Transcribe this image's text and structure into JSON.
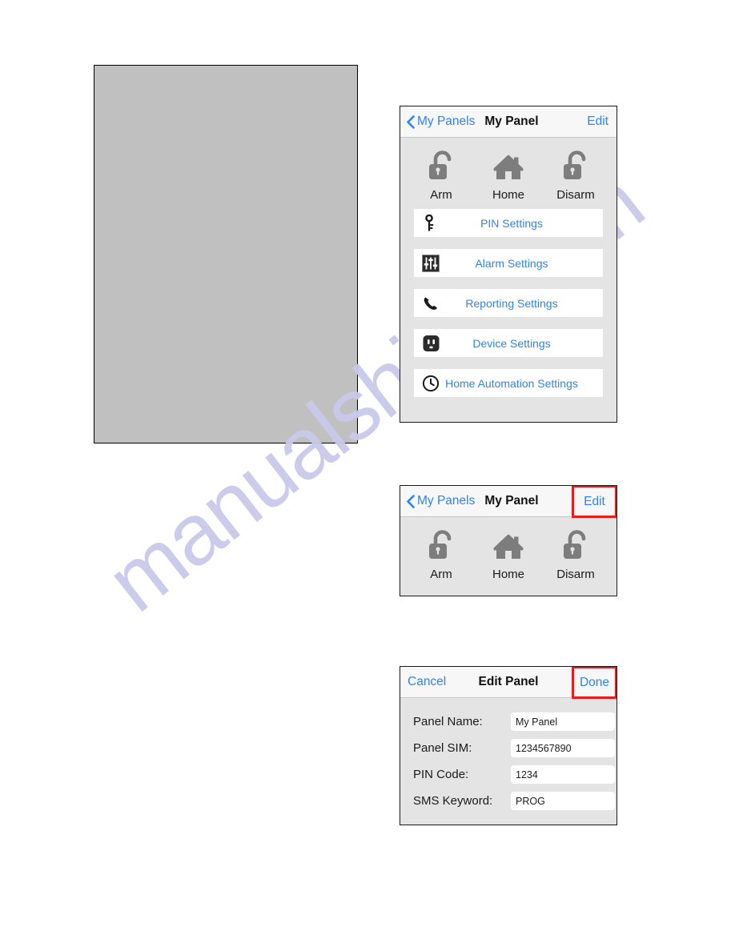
{
  "page": {
    "watermark_text": "manualshive.com",
    "watermark_color": "#c9c9ec",
    "accent_blue": "#2f84e8",
    "highlight_red": "#e81c1c"
  },
  "figure_placeholder": {
    "label": "blank-image-placeholder"
  },
  "panel_screen": {
    "nav": {
      "back_label": "My Panels",
      "title": "My Panel",
      "action_label": "Edit",
      "back_icon": "chevron-left-icon"
    },
    "modes": [
      {
        "label": "Arm",
        "icon": "open-padlock-icon"
      },
      {
        "label": "Home",
        "icon": "house-icon"
      },
      {
        "label": "Disarm",
        "icon": "open-padlock-icon"
      }
    ],
    "settings": [
      {
        "label": "PIN Settings",
        "icon": "key-icon"
      },
      {
        "label": "Alarm Settings",
        "icon": "sliders-icon"
      },
      {
        "label": "Reporting Settings",
        "icon": "phone-handset-icon"
      },
      {
        "label": "Device Settings",
        "icon": "power-outlet-icon"
      },
      {
        "label": "Home Automation Settings",
        "icon": "clock-icon"
      }
    ]
  },
  "panel_screen_edit_highlight": {
    "nav": {
      "back_label": "My Panels",
      "title": "My Panel",
      "action_label": "Edit",
      "back_icon": "chevron-left-icon"
    },
    "modes": [
      {
        "label": "Arm",
        "icon": "open-padlock-icon"
      },
      {
        "label": "Home",
        "icon": "house-icon"
      },
      {
        "label": "Disarm",
        "icon": "open-padlock-icon"
      }
    ]
  },
  "edit_panel_screen": {
    "nav": {
      "cancel_label": "Cancel",
      "title": "Edit Panel",
      "done_label": "Done"
    },
    "fields": [
      {
        "label": "Panel Name:",
        "value": "My Panel"
      },
      {
        "label": "Panel SIM:",
        "value": "1234567890"
      },
      {
        "label": "PIN Code:",
        "value": "1234"
      },
      {
        "label": "SMS Keyword:",
        "value": "PROG"
      }
    ]
  }
}
